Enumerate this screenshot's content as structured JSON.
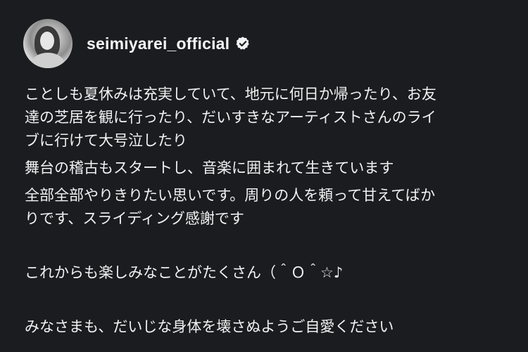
{
  "post": {
    "username": "seimiyarei_official",
    "verified_icon": "verified-badge-icon",
    "avatar_icon": "profile-photo",
    "caption": {
      "paragraph1": [
        "ことしも夏休みは充実していて、地元に何日か帰ったり、お友",
        "達の芝居を観に行ったり、だいすきなアーティストさんのライ",
        "ブに行けて大号泣したり"
      ],
      "paragraph2": "舞台の稽古もスタートし、音楽に囲まれて生きています",
      "paragraph3": [
        "全部全部やりきりたい思いです。周りの人を頼って甘えてばか",
        "りです、スライディング感謝です"
      ],
      "paragraph4": "これからも楽しみなことがたくさん（＾Ｏ＾☆♪",
      "paragraph5": "みなさまも、だいじな身体を壊さぬようご自愛ください"
    }
  },
  "colors": {
    "background": "#1b1c20",
    "text": "#f2f2f2"
  }
}
